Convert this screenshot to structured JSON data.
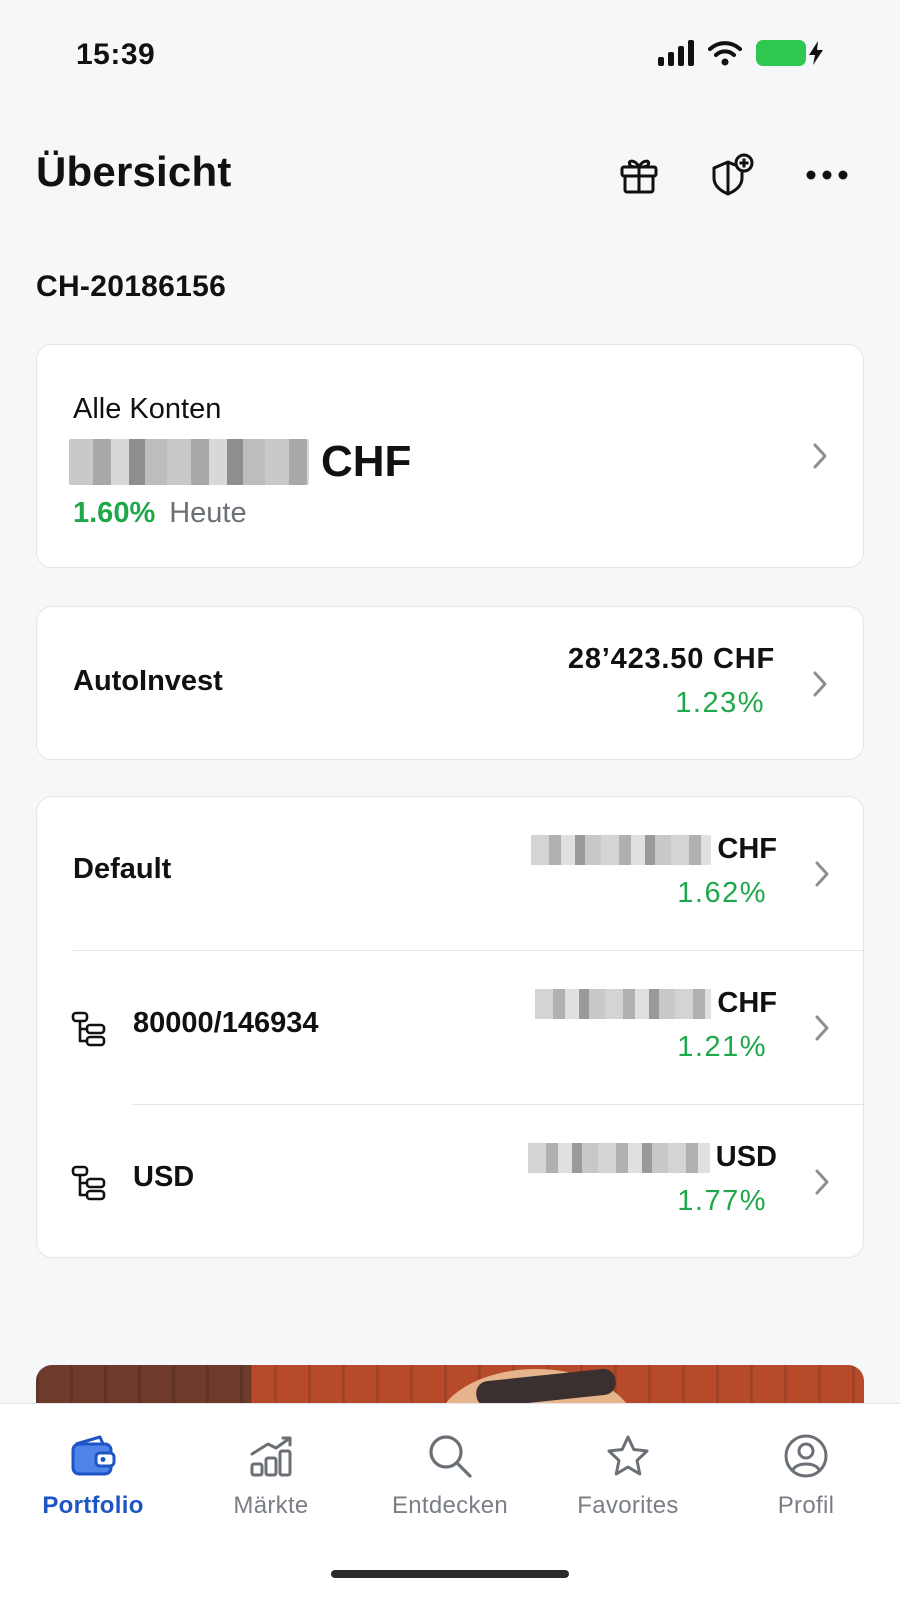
{
  "status_bar": {
    "time": "15:39"
  },
  "header": {
    "title": "Übersicht"
  },
  "account_id": "CH-20186156",
  "all_accounts": {
    "label": "Alle Konten",
    "currency": "CHF",
    "change": "1.60%",
    "change_period": "Heute"
  },
  "autoinvest": {
    "label": "AutoInvest",
    "value": "28’423.50 CHF",
    "change": "1.23%"
  },
  "accounts": [
    {
      "label": "Default",
      "currency": "CHF",
      "change": "1.62%"
    },
    {
      "label": "80000/146934",
      "currency": "CHF",
      "change": "1.21%"
    },
    {
      "label": "USD",
      "currency": "USD",
      "change": "1.77%"
    }
  ],
  "tabs": [
    {
      "label": "Portfolio",
      "icon": "wallet-icon",
      "active": true
    },
    {
      "label": "Märkte",
      "icon": "chart-growth-icon",
      "active": false
    },
    {
      "label": "Entdecken",
      "icon": "search-icon",
      "active": false
    },
    {
      "label": "Favorites",
      "icon": "star-icon",
      "active": false
    },
    {
      "label": "Profil",
      "icon": "profile-icon",
      "active": false
    }
  ],
  "colors": {
    "positive": "#1fa84a",
    "accent": "#1d55c4",
    "battery": "#2ec74f"
  }
}
